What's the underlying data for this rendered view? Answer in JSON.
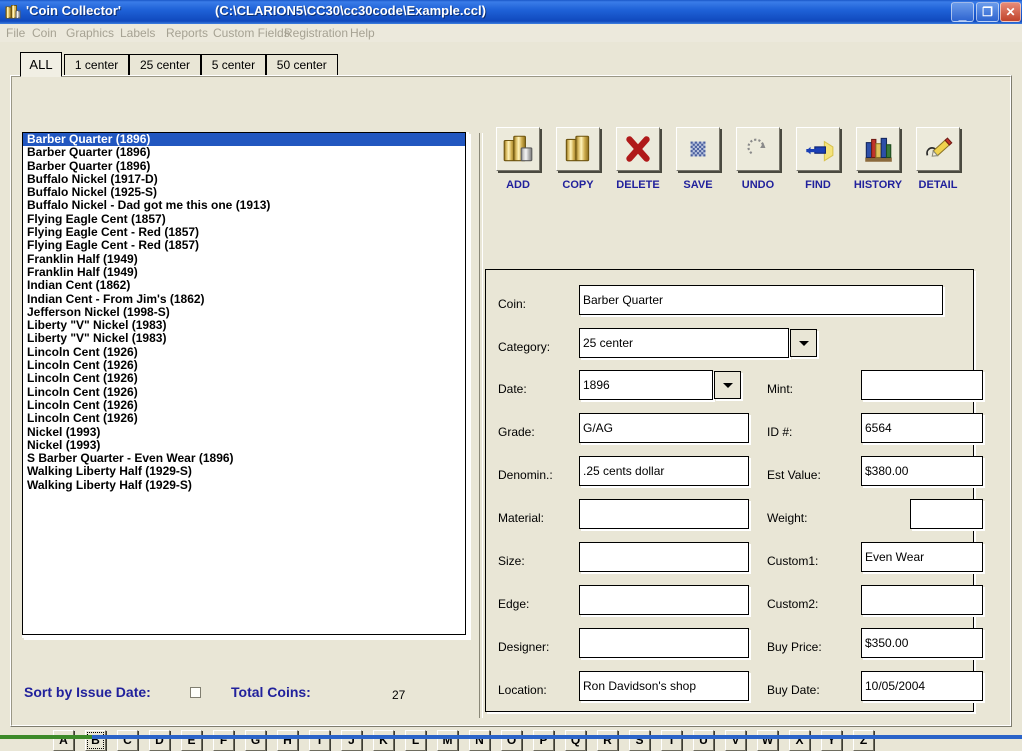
{
  "window": {
    "title": "'Coin Collector'",
    "path": "(C:\\CLARION5\\CC30\\cc30code\\Example.ccl)",
    "icon": "coin-stack-icon",
    "minimize": "_",
    "maximize": "❐",
    "close": "✕"
  },
  "menu": {
    "items": [
      "File",
      "Coin",
      "Graphics",
      "Labels",
      "Reports",
      "Custom Fields",
      "Registration",
      "Help"
    ]
  },
  "tabs": {
    "items": [
      {
        "label": "ALL",
        "selected": true
      },
      {
        "label": "1 center",
        "selected": false
      },
      {
        "label": "25 center",
        "selected": false
      },
      {
        "label": "5 center",
        "selected": false
      },
      {
        "label": "50 center",
        "selected": false
      }
    ]
  },
  "list": {
    "items": [
      {
        "label": "Barber Quarter (1896)",
        "selected": true
      },
      {
        "label": "Barber Quarter (1896)",
        "selected": false
      },
      {
        "label": "Barber Quarter (1896)",
        "selected": false
      },
      {
        "label": "Buffalo Nickel (1917-D)",
        "selected": false
      },
      {
        "label": "Buffalo Nickel (1925-S)",
        "selected": false
      },
      {
        "label": "Buffalo Nickel - Dad got me this one (1913)",
        "selected": false
      },
      {
        "label": "Flying Eagle Cent (1857)",
        "selected": false
      },
      {
        "label": "Flying Eagle Cent - Red (1857)",
        "selected": false
      },
      {
        "label": "Flying Eagle Cent - Red (1857)",
        "selected": false
      },
      {
        "label": "Franklin Half (1949)",
        "selected": false
      },
      {
        "label": "Franklin Half (1949)",
        "selected": false
      },
      {
        "label": "Indian Cent (1862)",
        "selected": false
      },
      {
        "label": "Indian Cent - From Jim's (1862)",
        "selected": false
      },
      {
        "label": "Jefferson Nickel (1998-S)",
        "selected": false
      },
      {
        "label": "Liberty \"V\" Nickel (1983)",
        "selected": false
      },
      {
        "label": "Liberty \"V\" Nickel (1983)",
        "selected": false
      },
      {
        "label": "Lincoln Cent (1926)",
        "selected": false
      },
      {
        "label": "Lincoln Cent (1926)",
        "selected": false
      },
      {
        "label": "Lincoln Cent (1926)",
        "selected": false
      },
      {
        "label": "Lincoln Cent (1926)",
        "selected": false
      },
      {
        "label": "Lincoln Cent (1926)",
        "selected": false
      },
      {
        "label": "Lincoln Cent (1926)",
        "selected": false
      },
      {
        "label": "Nickel (1993)",
        "selected": false
      },
      {
        "label": "Nickel (1993)",
        "selected": false
      },
      {
        "label": "S Barber Quarter - Even Wear (1896)",
        "selected": false
      },
      {
        "label": "Walking Liberty Half (1929-S)",
        "selected": false
      },
      {
        "label": "Walking Liberty Half (1929-S)",
        "selected": false
      }
    ]
  },
  "sort": {
    "label": "Sort by Issue Date:",
    "checked": false,
    "total_label": "Total Coins:",
    "total_value": "27"
  },
  "alphabet": {
    "letters": [
      "A",
      "B",
      "C",
      "D",
      "E",
      "F",
      "G",
      "H",
      "I",
      "J",
      "K",
      "L",
      "M",
      "N",
      "O",
      "P",
      "Q",
      "R",
      "S",
      "T",
      "U",
      "V",
      "W",
      "X",
      "Y",
      "Z"
    ],
    "focused": "B"
  },
  "toolbar": {
    "buttons": [
      {
        "label": "ADD",
        "icon": "add-coins-icon"
      },
      {
        "label": "COPY",
        "icon": "copy-coins-icon"
      },
      {
        "label": "DELETE",
        "icon": "red-x-icon"
      },
      {
        "label": "SAVE",
        "icon": "save-disk-icon"
      },
      {
        "label": "UNDO",
        "icon": "undo-arrow-icon"
      },
      {
        "label": "FIND",
        "icon": "flashlight-icon"
      },
      {
        "label": "HISTORY",
        "icon": "books-icon"
      },
      {
        "label": "DETAIL",
        "icon": "pencil-icon"
      }
    ]
  },
  "form": {
    "coin": {
      "label": "Coin:",
      "value": "Barber Quarter"
    },
    "category": {
      "label": "Category:",
      "value": "25 center"
    },
    "date": {
      "label": "Date:",
      "value": "1896"
    },
    "mint": {
      "label": "Mint:",
      "value": ""
    },
    "grade": {
      "label": "Grade:",
      "value": "G/AG"
    },
    "id": {
      "label": "ID #:",
      "value": "6564"
    },
    "denomin": {
      "label": "Denomin.:",
      "value": ".25 cents dollar"
    },
    "est_value": {
      "label": "Est Value:",
      "value": "$380.00"
    },
    "material": {
      "label": "Material:",
      "value": ""
    },
    "weight": {
      "label": "Weight:",
      "value": ""
    },
    "size": {
      "label": "Size:",
      "value": ""
    },
    "custom1": {
      "label": "Custom1:",
      "value": "Even Wear"
    },
    "edge": {
      "label": "Edge:",
      "value": ""
    },
    "custom2": {
      "label": "Custom2:",
      "value": ""
    },
    "designer": {
      "label": "Designer:",
      "value": ""
    },
    "buy_price": {
      "label": "Buy Price:",
      "value": "$350.00"
    },
    "location": {
      "label": "Location:",
      "value": "Ron Davidson's shop"
    },
    "buy_date": {
      "label": "Buy Date:",
      "value": "10/05/2004"
    }
  },
  "colors": {
    "face": "#e9e6d6",
    "titlebar": "#1f62d8",
    "selection": "#2257c0",
    "label_blue": "#21219c",
    "close_red": "#c0432c"
  }
}
